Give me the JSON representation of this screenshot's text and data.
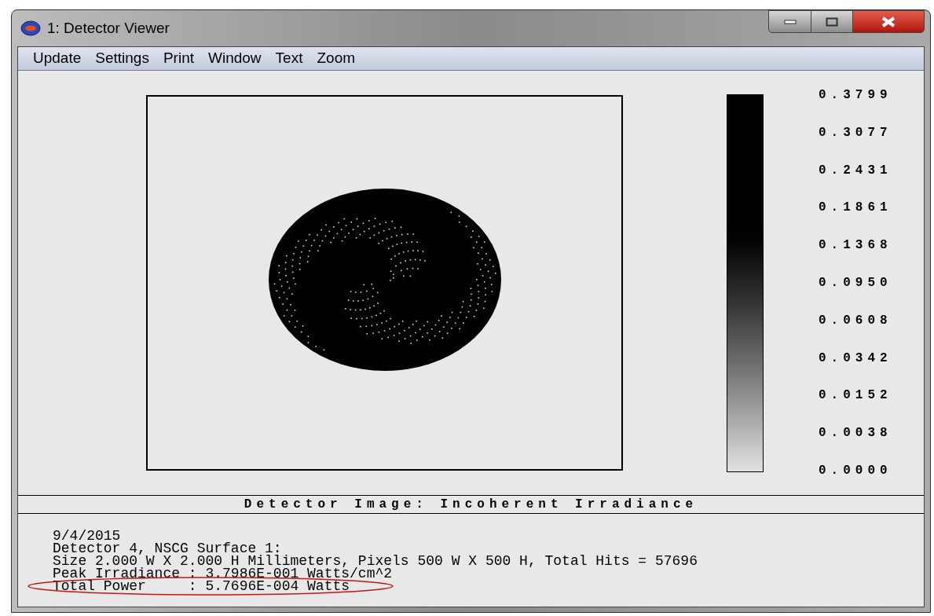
{
  "window": {
    "title": "1: Detector Viewer"
  },
  "menu": [
    "Update",
    "Settings",
    "Print",
    "Window",
    "Text",
    "Zoom"
  ],
  "scale_labels": [
    "0.3799",
    "0.3077",
    "0.2431",
    "0.1861",
    "0.1368",
    "0.0950",
    "0.0608",
    "0.0342",
    "0.0152",
    "0.0038",
    "0.0000"
  ],
  "caption": "Detector Image: Incoherent Irradiance",
  "info_lines": [
    {
      "text": "9/4/2015",
      "circled": false
    },
    {
      "text": "Detector 4, NSCG Surface 1:",
      "circled": false
    },
    {
      "text": "Size 2.000 W X 2.000 H Millimeters, Pixels 500 W X 500 H, Total Hits = 57696",
      "circled": false
    },
    {
      "text": "Peak Irradiance : 3.7986E-001 Watts/cm^2",
      "circled": false
    },
    {
      "text": "Total Power     : 5.7696E-004 Watts",
      "circled": true
    }
  ]
}
